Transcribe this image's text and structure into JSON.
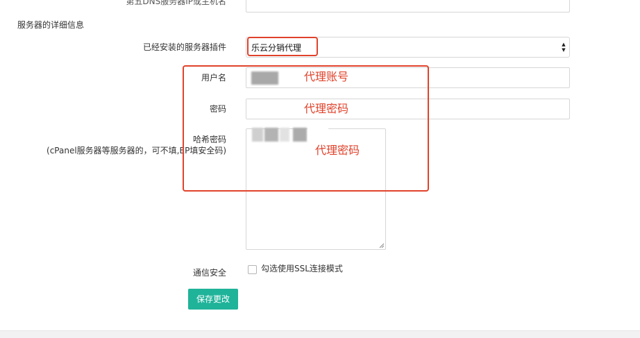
{
  "form": {
    "dns5_label": "第五DNS服务器IP或主机名",
    "section_title": "服务器的详细信息",
    "plugin_label": "已经安装的服务器插件",
    "plugin_selected": "乐云分销代理",
    "username_label": "用户名",
    "password_label": "密码",
    "hash_label": "哈希密码",
    "hash_hint": "(cPanel服务器等服务器的，可不填,EP填安全码)",
    "secure_label": "通信安全",
    "ssl_checkbox_label": "勾选使用SSL连接模式",
    "save_button": "保存更改"
  },
  "annotations": {
    "username_note": "代理账号",
    "password_note": "代理密码",
    "hash_note": "代理密码"
  },
  "colors": {
    "annotation": "#e0422b",
    "primary_button": "#1fb39a"
  }
}
